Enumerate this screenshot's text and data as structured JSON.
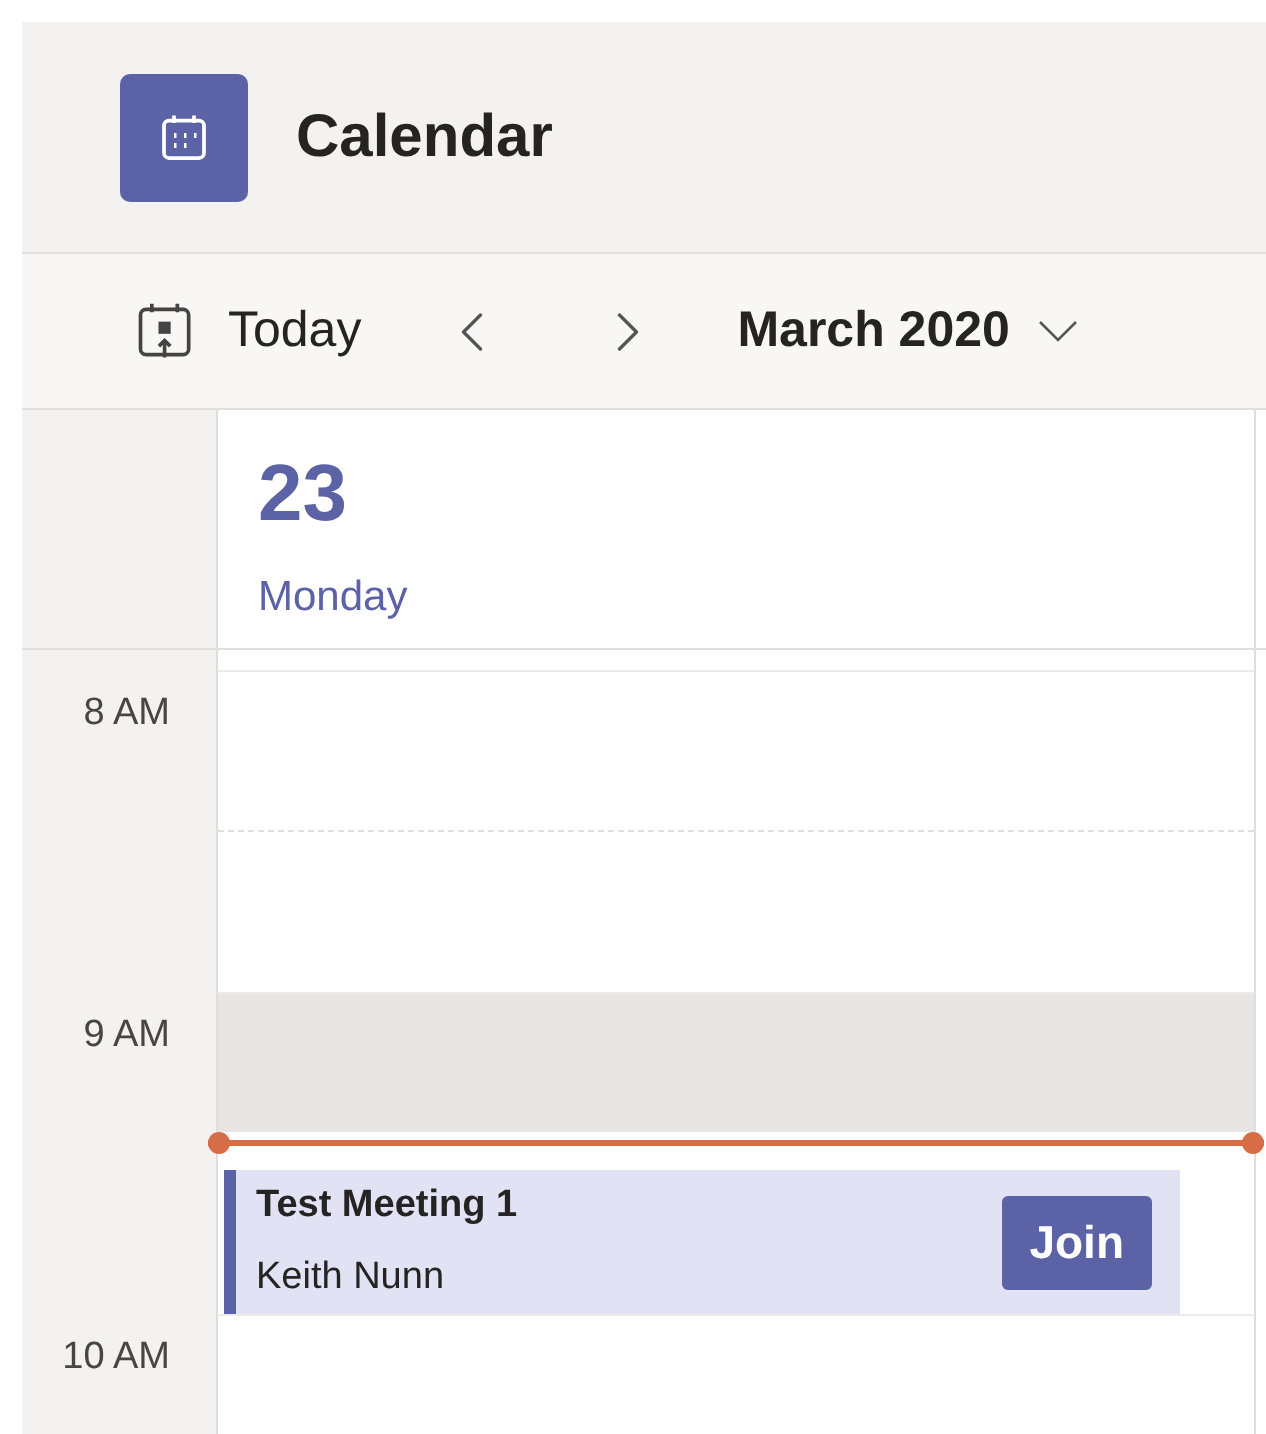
{
  "header": {
    "title": "Calendar"
  },
  "toolbar": {
    "today": "Today",
    "month": "March 2020"
  },
  "day": {
    "number": "23",
    "name": "Monday"
  },
  "hours": [
    "8 AM",
    "9 AM",
    "10 AM"
  ],
  "event": {
    "title": "Test Meeting 1",
    "organizer": "Keith Nunn",
    "action": "Join"
  }
}
